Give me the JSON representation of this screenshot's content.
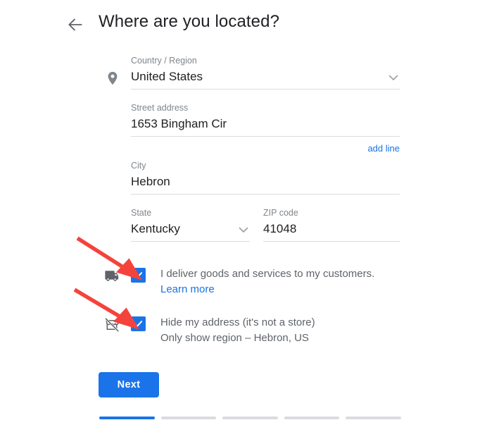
{
  "header": {
    "back_icon": "arrow-left-icon",
    "title": "Where are you located?"
  },
  "form": {
    "location_icon": "map-pin-icon",
    "fields": [
      {
        "label": "Country / Region",
        "value": "United States",
        "has_dropdown": true
      },
      {
        "label": "Street address",
        "value": "1653 Bingham Cir",
        "has_dropdown": false
      },
      {
        "label": "City",
        "value": "Hebron",
        "has_dropdown": false
      },
      {
        "label": "State",
        "value": "Kentucky",
        "has_dropdown": true
      },
      {
        "label": "ZIP code",
        "value": "41048",
        "has_dropdown": false
      }
    ],
    "add_line_label": "add line"
  },
  "options": [
    {
      "icon": "local-shipping-truck-icon",
      "checked": true,
      "text": "I deliver goods and services to my customers.",
      "link": "Learn more"
    },
    {
      "icon": "store-hidden-slash-icon",
      "checked": true,
      "text": "Hide my address (it's not a store)",
      "subtext": "Only show region – Hebron, US"
    }
  ],
  "footer": {
    "next_label": "Next",
    "progress": {
      "total_steps": 5,
      "current_step": 1
    }
  },
  "colors": {
    "accent": "#1a73e8",
    "label_gray": "#80868b",
    "value_dark": "#202124",
    "body_gray": "#5f6368",
    "underline": "#dadce0",
    "annotation_red": "#f4433c"
  }
}
